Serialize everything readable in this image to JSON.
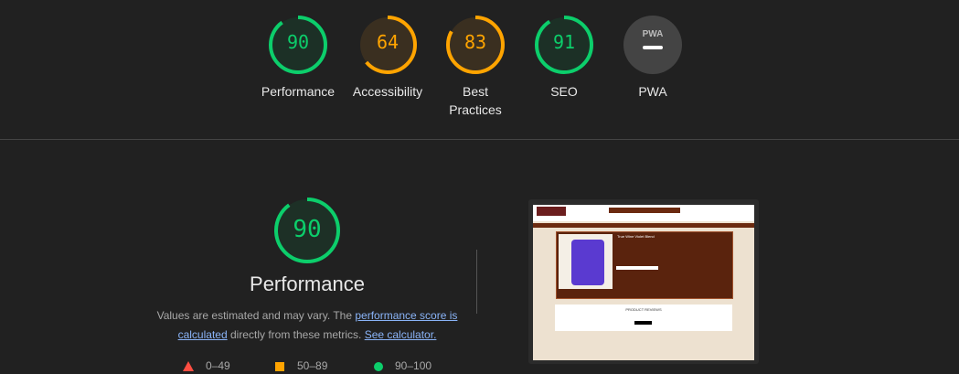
{
  "colors": {
    "pass": "#0cce6b",
    "average": "#ffa400",
    "fail": "#ff4e42",
    "pwa": "#444444"
  },
  "categories": [
    {
      "label": "Performance",
      "score": 90,
      "rating": "pass"
    },
    {
      "label": "Accessibility",
      "score": 64,
      "rating": "average"
    },
    {
      "label": "Best Practices",
      "score": 83,
      "rating": "average"
    },
    {
      "label": "SEO",
      "score": 91,
      "rating": "pass"
    },
    {
      "label": "PWA",
      "badge": "PWA",
      "rating": "na"
    }
  ],
  "performance": {
    "score": 90,
    "title": "Performance",
    "desc_prefix": "Values are estimated and may vary. The ",
    "link_score": "performance score is calculated",
    "desc_mid": " directly from these metrics. ",
    "link_calc": "See calculator."
  },
  "legend": [
    {
      "range": "0–49",
      "icon": "triangle-icon"
    },
    {
      "range": "50–89",
      "icon": "square-icon"
    },
    {
      "range": "90–100",
      "icon": "circle-icon"
    }
  ],
  "screenshot": {
    "product_title": "True Wine Violet Blend",
    "reviews_heading": "PRODUCT REVIEWS"
  }
}
